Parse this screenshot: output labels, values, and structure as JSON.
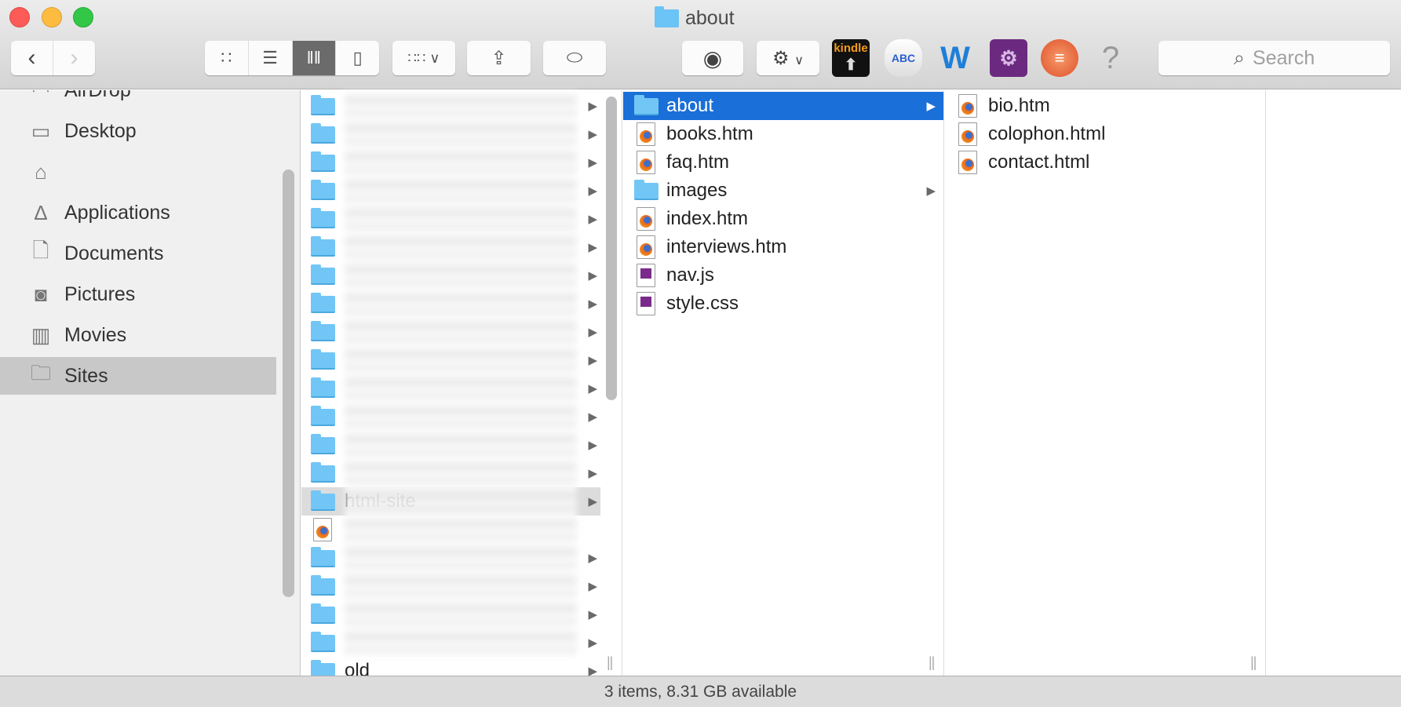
{
  "window": {
    "title": "about",
    "colors": {
      "close": "#fc5b57",
      "minimize": "#fdbc40",
      "zoom": "#33c748",
      "selection": "#1a6fd8"
    }
  },
  "toolbar": {
    "back_icon": "chevron-left-icon",
    "forward_icon": "chevron-right-icon",
    "view_modes": [
      "icon-view",
      "list-view",
      "column-view",
      "cover-flow-view"
    ],
    "active_view": "column-view",
    "arrange_icon": "arrange-grid-icon",
    "share_icon": "share-icon",
    "tag_icon": "tag-icon",
    "quicklook_icon": "eye-icon",
    "action_icon": "gear-icon",
    "kindle_label": "kindle",
    "apps": [
      "kindle-icon",
      "abc-dictation-icon",
      "word-icon",
      "automator-icon",
      "stack-app-icon",
      "help-icon"
    ],
    "search_placeholder": "Search"
  },
  "sidebar": {
    "items": [
      {
        "label": "AirDrop",
        "icon": "airdrop-icon"
      },
      {
        "label": "Desktop",
        "icon": "desktop-icon"
      },
      {
        "label": "",
        "icon": "home-icon"
      },
      {
        "label": "Applications",
        "icon": "applications-icon"
      },
      {
        "label": "Documents",
        "icon": "documents-icon"
      },
      {
        "label": "Pictures",
        "icon": "camera-icon"
      },
      {
        "label": "Movies",
        "icon": "film-icon"
      },
      {
        "label": "Sites",
        "icon": "folder-icon",
        "selected": true
      }
    ]
  },
  "columns": [
    {
      "items": [
        {
          "name": "",
          "type": "folder"
        },
        {
          "name": "",
          "type": "folder"
        },
        {
          "name": "",
          "type": "folder"
        },
        {
          "name": "",
          "type": "folder"
        },
        {
          "name": "",
          "type": "folder"
        },
        {
          "name": "",
          "type": "folder"
        },
        {
          "name": "",
          "type": "folder"
        },
        {
          "name": "",
          "type": "folder"
        },
        {
          "name": "",
          "type": "folder"
        },
        {
          "name": "",
          "type": "folder"
        },
        {
          "name": "",
          "type": "folder"
        },
        {
          "name": "",
          "type": "folder"
        },
        {
          "name": "",
          "type": "folder"
        },
        {
          "name": "",
          "type": "folder"
        },
        {
          "name": "html-site",
          "type": "folder",
          "highlighted": true
        },
        {
          "name": "",
          "type": "html"
        },
        {
          "name": "",
          "type": "folder"
        },
        {
          "name": "",
          "type": "folder"
        },
        {
          "name": "",
          "type": "folder"
        },
        {
          "name": "",
          "type": "folder"
        },
        {
          "name": "old",
          "type": "folder"
        }
      ]
    },
    {
      "items": [
        {
          "name": "about",
          "type": "folder",
          "selected": true
        },
        {
          "name": "books.htm",
          "type": "html"
        },
        {
          "name": "faq.htm",
          "type": "html"
        },
        {
          "name": "images",
          "type": "folder"
        },
        {
          "name": "index.htm",
          "type": "html"
        },
        {
          "name": "interviews.htm",
          "type": "html"
        },
        {
          "name": "nav.js",
          "type": "script"
        },
        {
          "name": "style.css",
          "type": "script"
        }
      ]
    },
    {
      "items": [
        {
          "name": "bio.htm",
          "type": "html"
        },
        {
          "name": "colophon.html",
          "type": "html"
        },
        {
          "name": "contact.html",
          "type": "html"
        }
      ]
    }
  ],
  "status": {
    "text": "3 items, 8.31 GB available"
  }
}
